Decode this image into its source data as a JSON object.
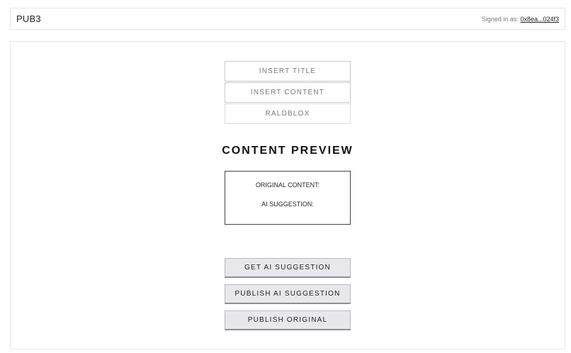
{
  "header": {
    "brand": "PUB3",
    "signed_in_label": "Signed in as:",
    "account": "0x8ea...024f3"
  },
  "form": {
    "title_placeholder": "INSERT TITLE",
    "content_placeholder": "INSERT CONTENT",
    "tag_value": "RALDBLOX"
  },
  "preview": {
    "heading": "CONTENT PREVIEW",
    "original_label": "ORIGINAL CONTENT:",
    "ai_label": "AI SUGGESTION:"
  },
  "actions": {
    "get_ai": "GET AI SUGGESTION",
    "publish_ai": "PUBLISH AI SUGGESTION",
    "publish_original": "PUBLISH ORIGINAL"
  }
}
